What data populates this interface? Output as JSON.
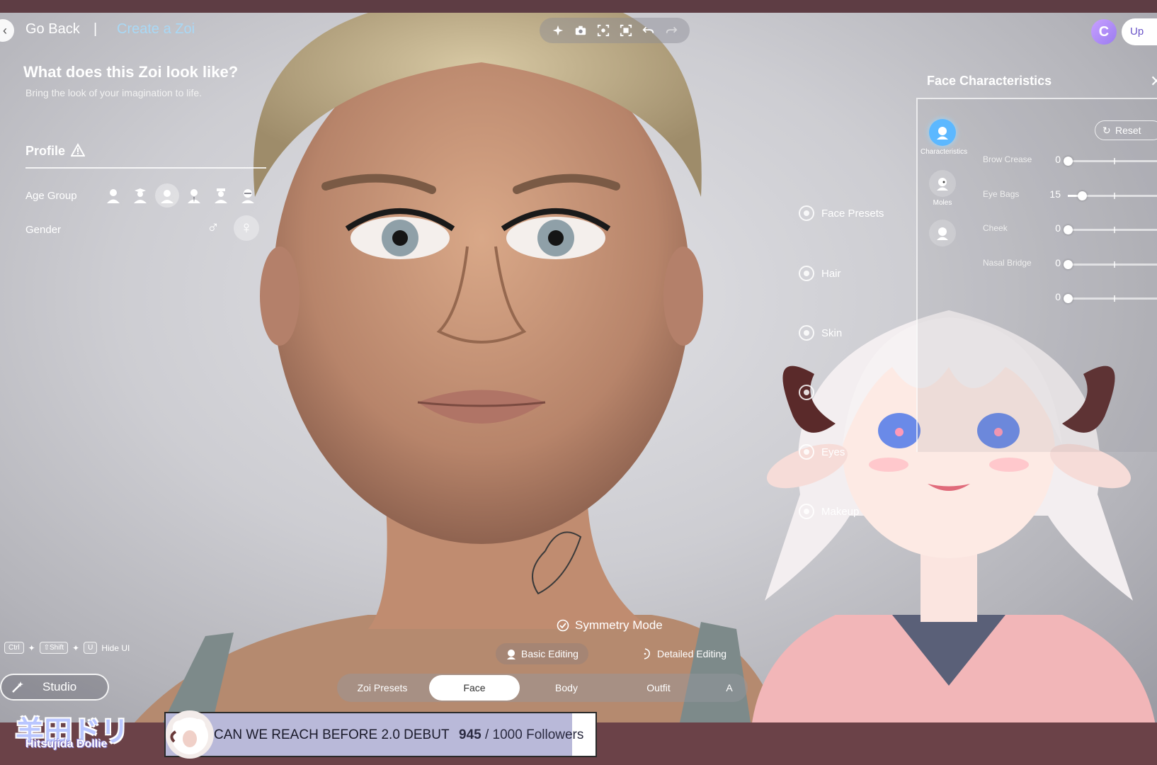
{
  "header": {
    "go_back": "Go Back",
    "separator": "|",
    "create": "Create a Zoi",
    "toolbar": [
      "sparkle-icon",
      "camera-icon",
      "focus-icon",
      "fullscreen-focus-icon",
      "undo-icon",
      "redo-icon"
    ],
    "upgrade_label": "Up"
  },
  "left_panel": {
    "title": "What does this Zoi look like?",
    "subtitle": "Bring the look of your imagination to life.",
    "profile": "Profile",
    "age_group_label": "Age Group",
    "gender_label": "Gender",
    "gender_male": "♂",
    "gender_female": "♀"
  },
  "categories": [
    "Face Presets",
    "Hair",
    "Skin",
    "",
    "Eyes",
    "Makeup"
  ],
  "face_panel": {
    "title": "Face Characteristics",
    "close": "✕",
    "reset": "Reset",
    "tabs": [
      "Characteristics",
      "Moles"
    ],
    "sliders": [
      {
        "label": "Brow Crease",
        "value": 0
      },
      {
        "label": "Eye Bags",
        "value": 15
      },
      {
        "label": "Cheek",
        "value": 0
      },
      {
        "label": "Nasal Bridge",
        "value": 0
      },
      {
        "label": "",
        "value": 0
      }
    ]
  },
  "bottom": {
    "symmetry": "Symmetry Mode",
    "basic_editing": "Basic Editing",
    "detailed_editing": "Detailed Editing",
    "tabs": [
      "Zoi Presets",
      "Face",
      "Body",
      "Outfit",
      "A"
    ],
    "selected_tab": "Face",
    "hide_ui_keys": [
      "Ctrl",
      "⇧Shift",
      "U"
    ],
    "hide_ui": "Hide UI",
    "studio": "Studio"
  },
  "overlay": {
    "logo_jp": "羊田ドリー",
    "logo_en": "Hitsujida Dollie",
    "goal_text": "CAN WE REACH BEFORE 2.0 DEBUT",
    "goal_current": "945",
    "goal_rest": " / 1000 Followers",
    "goal_progress": 0.945
  }
}
